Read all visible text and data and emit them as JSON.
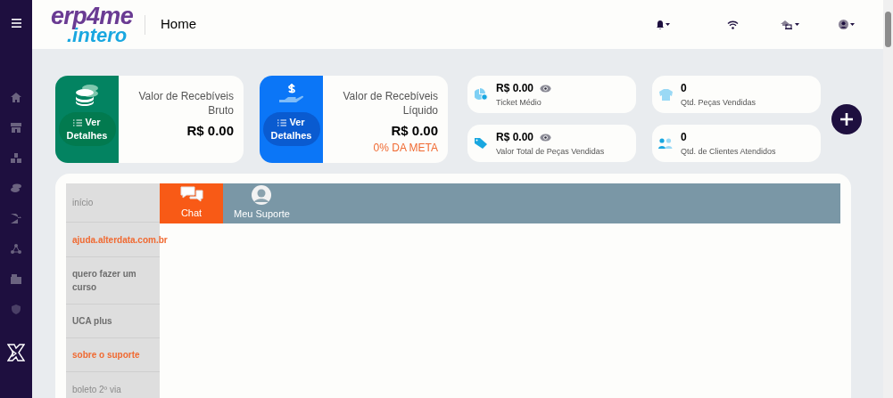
{
  "header": {
    "page_title": "Home"
  },
  "logo": {
    "line_1": "erp4me",
    "line_2": ".intero"
  },
  "summary_cards": [
    {
      "kind": "green",
      "title": "Valor de Recebíveis Bruto",
      "value": "R$ 0.00",
      "button": "Ver Detalhes"
    },
    {
      "kind": "blue",
      "title": "Valor de Recebíveis Líquido",
      "value": "R$ 0.00",
      "goal": "0% DA META",
      "button": "Ver Detalhes"
    }
  ],
  "stat_cards": [
    {
      "kind": "ticket",
      "value": "R$ 0.00",
      "label": "Ticket Médio",
      "hideable": true
    },
    {
      "kind": "shirt",
      "value": "0",
      "label": "Qtd. Peças Vendidas",
      "hideable": false
    },
    {
      "kind": "tag",
      "value": "R$ 0.00",
      "label": "Valor Total de Peças Vendidas",
      "hideable": true
    },
    {
      "kind": "people",
      "value": "0",
      "label": "Qtd. de Clientes Atendidos",
      "hideable": false
    }
  ],
  "support": {
    "menu": [
      {
        "kind": "plain",
        "label": "início"
      },
      {
        "kind": "accent",
        "label": "ajuda.alterdata.com.br"
      },
      {
        "kind": "bold",
        "label": "quero fazer um curso"
      },
      {
        "kind": "bold",
        "label": "UCA plus"
      },
      {
        "kind": "accent",
        "label": "sobre o suporte"
      },
      {
        "kind": "plain",
        "label": "boleto 2º via"
      }
    ],
    "tabs": [
      {
        "kind": "chat",
        "label": "Chat",
        "selected": true
      },
      {
        "kind": "person",
        "label": "Meu Suporte",
        "selected": false
      }
    ]
  }
}
